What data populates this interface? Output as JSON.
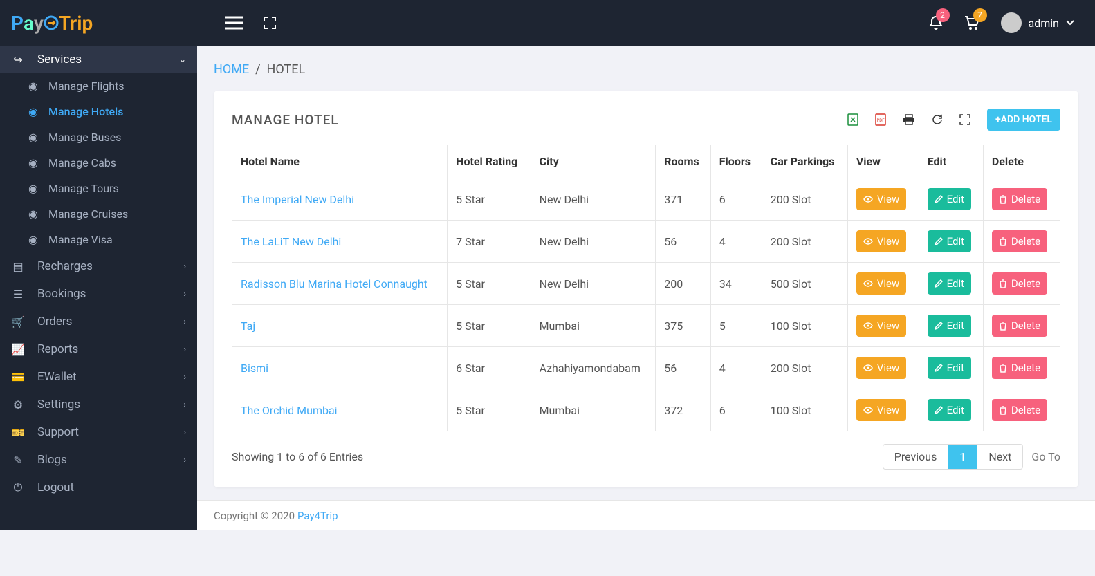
{
  "brand": {
    "p": "Pay",
    "o": "o",
    "trip": "Trip"
  },
  "header": {
    "notif_count": "2",
    "cart_count": "7",
    "username": "admin"
  },
  "breadcrumb": {
    "home": "HOME",
    "sep": "/",
    "current": "HOTEL"
  },
  "page": {
    "title": "MANAGE HOTEL",
    "add_btn": "+ADD HOTEL"
  },
  "sidebar": {
    "services": "Services",
    "sub": [
      "Manage Flights",
      "Manage Hotels",
      "Manage Buses",
      "Manage Cabs",
      "Manage Tours",
      "Manage Cruises",
      "Manage Visa"
    ],
    "items": [
      "Recharges",
      "Bookings",
      "Orders",
      "Reports",
      "EWallet",
      "Settings",
      "Support",
      "Blogs",
      "Logout"
    ]
  },
  "table": {
    "headers": [
      "Hotel Name",
      "Hotel Rating",
      "City",
      "Rooms",
      "Floors",
      "Car Parkings",
      "View",
      "Edit",
      "Delete"
    ],
    "rows": [
      {
        "name": "The Imperial New Delhi",
        "rating": "5 Star",
        "city": "New Delhi",
        "rooms": "371",
        "floors": "6",
        "parking": "200 Slot"
      },
      {
        "name": "The LaLiT New Delhi",
        "rating": "7 Star",
        "city": "New Delhi",
        "rooms": "56",
        "floors": "4",
        "parking": "200 Slot"
      },
      {
        "name": "Radisson Blu Marina Hotel Connaught",
        "rating": "5 Star",
        "city": "New Delhi",
        "rooms": "200",
        "floors": "34",
        "parking": "500 Slot"
      },
      {
        "name": "Taj",
        "rating": "5 Star",
        "city": "Mumbai",
        "rooms": "375",
        "floors": "5",
        "parking": "100 Slot"
      },
      {
        "name": "Bismi",
        "rating": "6 Star",
        "city": "Azhahiyamondabam",
        "rooms": "56",
        "floors": "4",
        "parking": "200 Slot"
      },
      {
        "name": "The Orchid Mumbai",
        "rating": "5 Star",
        "city": "Mumbai",
        "rooms": "372",
        "floors": "6",
        "parking": "100 Slot"
      }
    ],
    "view": "View",
    "edit": "Edit",
    "delete": "Delete"
  },
  "footer_table": {
    "entries": "Showing 1 to 6 of 6 Entries",
    "prev": "Previous",
    "next": "Next",
    "page": "1",
    "goto": "Go To"
  },
  "footer": {
    "copy": "Copyright © 2020 ",
    "brand": "Pay4Trip"
  }
}
